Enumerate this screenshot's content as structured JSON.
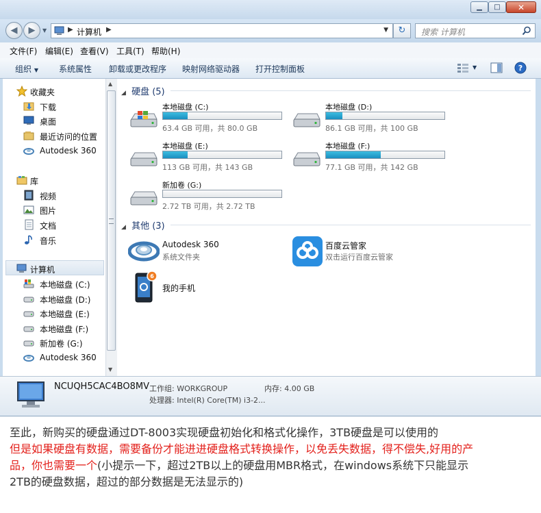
{
  "window": {
    "caption_buttons": {
      "minimize": "▁",
      "maximize": "□",
      "close": "✕"
    }
  },
  "address": {
    "path_label": "计算机",
    "refresh_glyph": "↻",
    "search_placeholder": "搜索 计算机"
  },
  "menu": [
    "文件(F)",
    "编辑(E)",
    "查看(V)",
    "工具(T)",
    "帮助(H)"
  ],
  "toolbar": {
    "organize": "组织",
    "items": [
      "系统属性",
      "卸载或更改程序",
      "映射网络驱动器",
      "打开控制面板"
    ]
  },
  "sidebar": {
    "favorites": {
      "title": "收藏夹",
      "items": [
        "下载",
        "桌面",
        "最近访问的位置",
        "Autodesk 360"
      ]
    },
    "libraries": {
      "title": "库",
      "items": [
        "视频",
        "图片",
        "文档",
        "音乐"
      ]
    },
    "computer": {
      "title": "计算机",
      "items": [
        "本地磁盘 (C:)",
        "本地磁盘 (D:)",
        "本地磁盘 (E:)",
        "本地磁盘 (F:)",
        "新加卷 (G:)",
        "Autodesk 360"
      ]
    }
  },
  "groups": {
    "disks": "硬盘 (5)",
    "other": "其他 (3)"
  },
  "drives": [
    {
      "name": "本地磁盘 (C:)",
      "free": "63.4 GB 可用，共 80.0 GB",
      "used_fraction": 0.21
    },
    {
      "name": "本地磁盘 (D:)",
      "free": "86.1 GB 可用，共 100 GB",
      "used_fraction": 0.14
    },
    {
      "name": "本地磁盘 (E:)",
      "free": "113 GB 可用，共 143 GB",
      "used_fraction": 0.21
    },
    {
      "name": "本地磁盘 (F:)",
      "free": "77.1 GB 可用，共 142 GB",
      "used_fraction": 0.46
    },
    {
      "name": "新加卷 (G:)",
      "free": "2.72 TB 可用，共 2.72 TB",
      "used_fraction": 0.0
    }
  ],
  "others": [
    {
      "name": "Autodesk 360",
      "sub": "系统文件夹"
    },
    {
      "name": "百度云管家",
      "sub": "双击运行百度云管家"
    },
    {
      "name": "我的手机",
      "sub": ""
    }
  ],
  "status": {
    "computer_name": "NCUQH5CAC4BO8MV",
    "workgroup": "工作组: WORKGROUP",
    "memory": "内存: 4.00 GB",
    "processor": "处理器: Intel(R) Core(TM) i3-2..."
  },
  "caption": {
    "line1": "至此，新购买的硬盘通过DT-8003实现硬盘初始化和格式化操作，3TB硬盘是可以使用的",
    "line2_red": "但是如果硬盘有数据，需要备份才能进进硬盘格式转换操作，以免丢失数据，得不偿失,好用的产",
    "line3_red": "品，你也需要一个",
    "line3_rest": "(小提示一下，超过2TB以上的硬盘用MBR格式，在windows系统下只能显示",
    "line4": "2TB的硬盘数据，超过的部分数据是无法显示的)"
  },
  "colors": {
    "accent": "#1e3a6e",
    "bar_fill": "#1a8fc0",
    "red_text": "#e3201b"
  }
}
